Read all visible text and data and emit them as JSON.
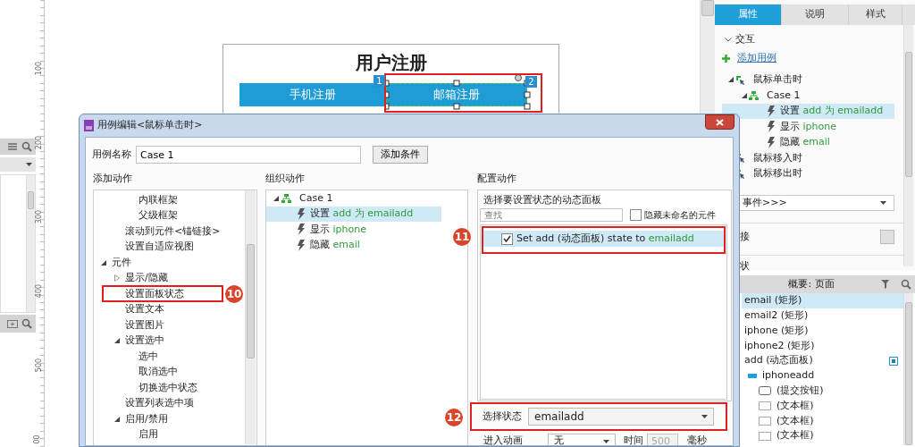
{
  "ruler": {
    "labels": [
      "100",
      "200",
      "300",
      "400",
      "500",
      "00"
    ]
  },
  "page": {
    "title": "用户注册",
    "tabs": [
      {
        "label": "手机注册",
        "badge": "1",
        "selected": false,
        "annotated": false
      },
      {
        "label": "邮箱注册",
        "badge": "2",
        "selected": true,
        "annotated": true
      }
    ]
  },
  "properties_panel": {
    "tabs": [
      {
        "label": "属性",
        "selected": true
      },
      {
        "label": "说明",
        "selected": false
      },
      {
        "label": "样式",
        "selected": false
      }
    ],
    "section": "交互",
    "add_case": "添加用例",
    "events": [
      {
        "label": "鼠标单击时",
        "expanded": true,
        "cases": [
          {
            "label": "Case 1",
            "expanded": true,
            "actions": [
              {
                "verb": "设置",
                "target": "add 为 emailadd",
                "selected": true
              },
              {
                "verb": "显示",
                "target": "iphone",
                "selected": false
              },
              {
                "verb": "隐藏",
                "target": "email",
                "selected": false
              }
            ]
          }
        ]
      },
      {
        "label": "鼠标移入时"
      },
      {
        "label": "鼠标移出时"
      }
    ],
    "more_events": "事件>>>",
    "link_label": "接",
    "shape_label": "状"
  },
  "outline_panel": {
    "title": "概要: 页面",
    "items": [
      {
        "label": "email (矩形)",
        "kind": "widget",
        "selected": true
      },
      {
        "label": "email2 (矩形)",
        "kind": "widget",
        "selected": false
      },
      {
        "label": "iphone (矩形)",
        "kind": "widget",
        "selected": false
      },
      {
        "label": "iphone2 (矩形)",
        "kind": "widget",
        "selected": false
      },
      {
        "label": "add (动态面板)",
        "kind": "panel",
        "selected": false,
        "children": [
          {
            "label": "iphoneadd",
            "kind": "state",
            "selected": false,
            "children": [
              {
                "label": "(提交按钮)",
                "kind": "button",
                "selected": false
              },
              {
                "label": "(文本框)",
                "kind": "textbox",
                "selected": false
              },
              {
                "label": "(文本框)",
                "kind": "textbox",
                "selected": false
              },
              {
                "label": "(文本框)",
                "kind": "textbox",
                "selected": false
              }
            ]
          }
        ]
      }
    ]
  },
  "dialog": {
    "title": "用例编辑<鼠标单击时>",
    "case_name_label": "用例名称",
    "case_name": "Case 1",
    "add_condition": "添加条件",
    "add_action": {
      "heading": "添加动作",
      "items": [
        {
          "children": [
            {
              "children": [
                {
                  "label": "内联框架"
                },
                {
                  "label": "父级框架"
                }
              ]
            },
            {
              "label": "滚动到元件<锚链接>"
            },
            {
              "label": "设置自适应视图"
            }
          ]
        },
        {
          "label": "元件",
          "expanded": true,
          "children": [
            {
              "label": "显示/隐藏",
              "expanded": false
            },
            {
              "label": "设置面板状态",
              "callout": "10"
            },
            {
              "label": "设置文本"
            },
            {
              "label": "设置图片"
            },
            {
              "label": "设置选中",
              "expanded": true,
              "children": [
                {
                  "label": "选中"
                },
                {
                  "label": "取消选中"
                },
                {
                  "label": "切换选中状态"
                }
              ]
            },
            {
              "label": "设置列表选中项"
            },
            {
              "label": "启用/禁用",
              "expanded": true,
              "children": [
                {
                  "label": "启用"
                }
              ]
            }
          ]
        }
      ]
    },
    "organize": {
      "heading": "组织动作",
      "case": "Case 1",
      "expanded": true,
      "actions": [
        {
          "verb": "设置",
          "target": "add 为 emailadd",
          "selected": true
        },
        {
          "verb": "显示",
          "target": "iphone",
          "selected": false
        },
        {
          "verb": "隐藏",
          "target": "email",
          "selected": false
        }
      ]
    },
    "configure": {
      "heading": "配置动作",
      "prompt": "选择要设置状态的动态面板",
      "search_placeholder": "查找",
      "hide_unnamed": {
        "label": "隐藏未命名的元件",
        "checked": false
      },
      "panels": [
        {
          "text": "Set add (动态面板) state to",
          "state": "emailadd",
          "checked": true,
          "selected": true,
          "callout": "11"
        }
      ],
      "state_select": {
        "label": "选择状态",
        "value": "emailadd",
        "callout": "12"
      },
      "animation": {
        "label": "进入动画",
        "value": "无",
        "time_label": "时间",
        "time": "500",
        "time_disabled": true,
        "unit": "毫秒"
      }
    }
  }
}
